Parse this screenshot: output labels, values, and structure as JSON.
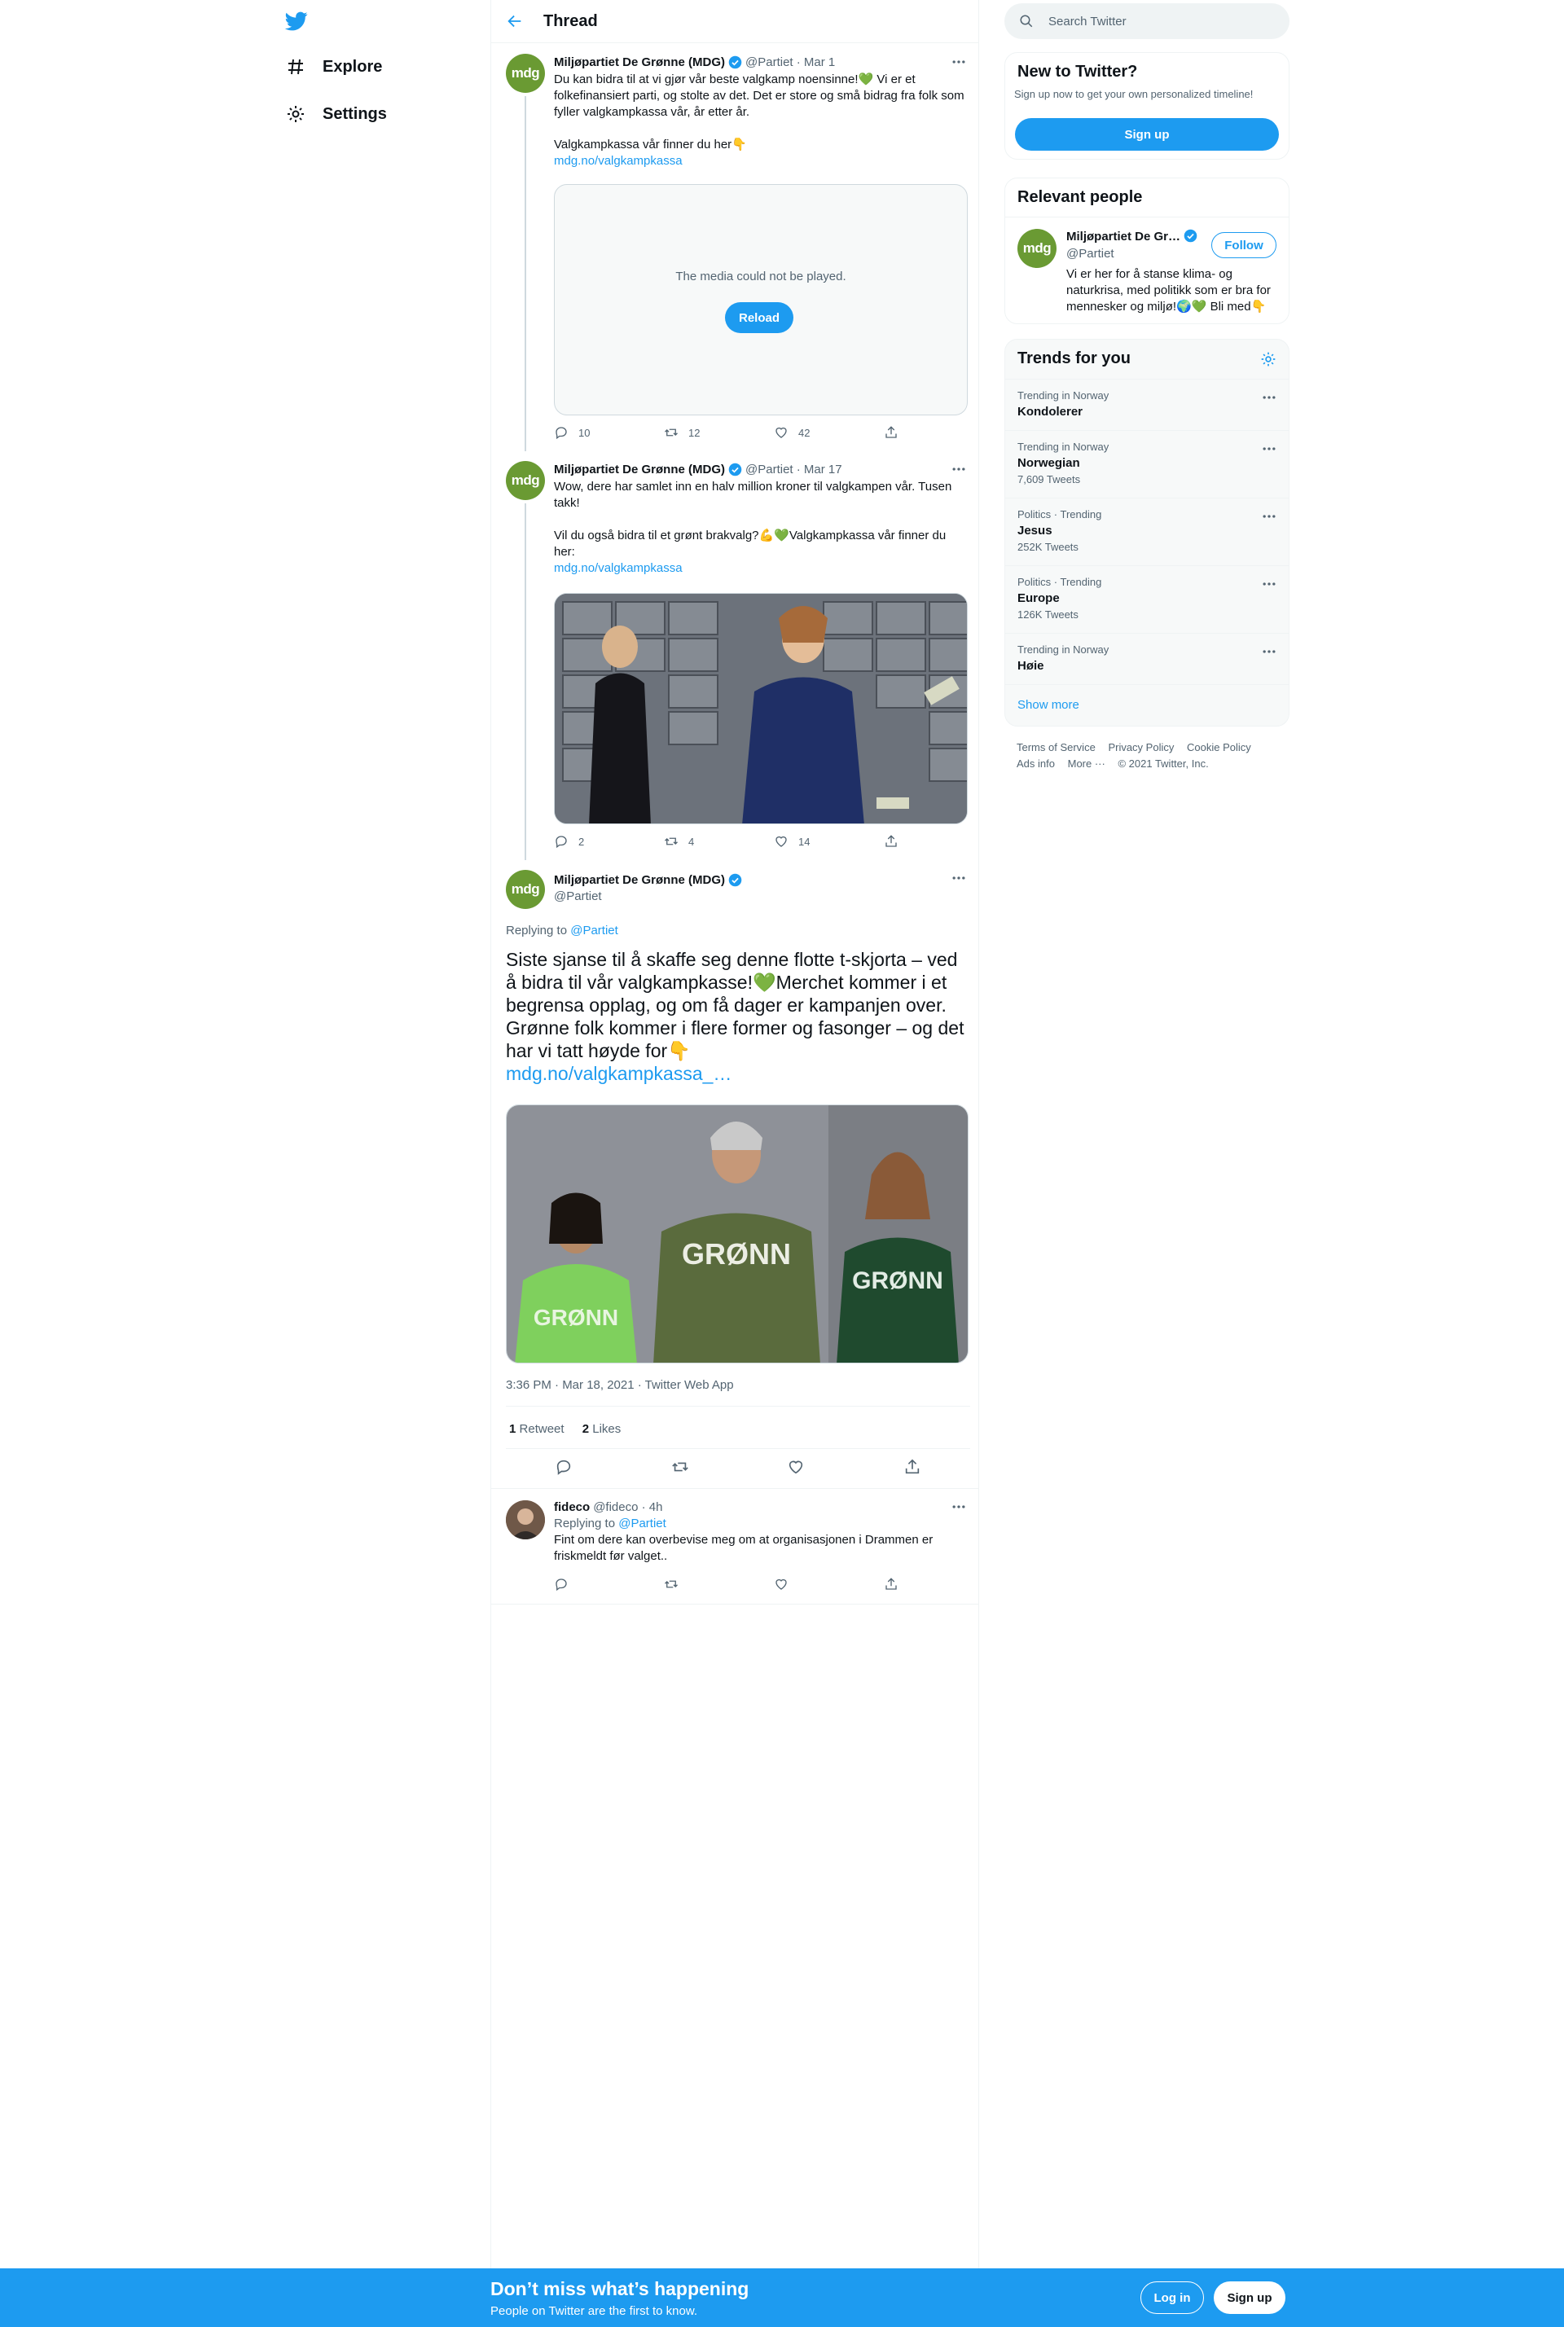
{
  "nav": {
    "explore": "Explore",
    "settings": "Settings"
  },
  "header": {
    "title": "Thread"
  },
  "tweets": [
    {
      "name": "Miljøpartiet De Grønne (MDG)",
      "avatar": "mdg",
      "meta": "@Partiet · Mar 1",
      "text": "Du kan bidra til at vi gjør vår beste valgkamp noensinne!💚 Vi er et folkefinansiert parti, og stolte av det. Det er store og små bidrag fra folk som fyller valgkampkassa vår, år etter år.\n\nValgkampkassa vår finner du her👇",
      "link": "mdg.no/valgkampkassa",
      "media_msg": "The media could not be played.",
      "reload": "Reload",
      "replies": "10",
      "retweets": "12",
      "likes": "42"
    },
    {
      "name": "Miljøpartiet De Grønne (MDG)",
      "avatar": "mdg",
      "meta": "@Partiet · Mar 17",
      "text": "Wow, dere har samlet inn en halv million kroner til valgkampen vår. Tusen takk!\n\nVil du også bidra til et grønt brakvalg?💪💚Valgkampkassa vår finner du her:",
      "link": "mdg.no/valgkampkassa",
      "replies": "2",
      "retweets": "4",
      "likes": "14"
    }
  ],
  "main_tweet": {
    "name": "Miljøpartiet De Grønne (MDG)",
    "handle": "@Partiet",
    "avatar": "mdg",
    "replying_prefix": "Replying to ",
    "replying_to": "@Partiet",
    "text": "Siste sjanse til å skaffe seg denne flotte t-skjorta – ved å bidra til vår valgkampkasse!💚Merchet kommer i et begrensa opplag, og om få dager er kampanjen over. Grønne folk kommer i flere former og fasonger – og det har vi tatt høyde for👇",
    "link": "mdg.no/valgkampkassa_…",
    "shirt_text": "GRØNN",
    "timestamp": "3:36 PM · Mar 18, 2021 · Twitter Web App",
    "retweets_num": "1",
    "retweets_label": "Retweet",
    "likes_num": "2",
    "likes_label": "Likes"
  },
  "reply": {
    "name": "fideco",
    "meta": "@fideco · 4h",
    "replying_prefix": "Replying to ",
    "replying_to": "@Partiet",
    "text": "Fint om dere kan overbevise meg om at organisasjonen i Drammen er friskmeldt før valget.."
  },
  "search": {
    "placeholder": "Search Twitter"
  },
  "new_to_twitter": {
    "title": "New to Twitter?",
    "subtitle": "Sign up now to get your own personalized timeline!",
    "signup": "Sign up"
  },
  "relevant": {
    "title": "Relevant people",
    "name": "Miljøpartiet De Gr…",
    "handle": "@Partiet",
    "avatar": "mdg",
    "follow": "Follow",
    "bio": "Vi er her for å stanse klima- og naturkrisa, med politikk som er bra for mennesker og miljø!🌍💚 Bli med👇"
  },
  "trends": {
    "title": "Trends for you",
    "items": [
      {
        "context": "Trending in Norway",
        "name": "Kondolerer",
        "count": ""
      },
      {
        "context": "Trending in Norway",
        "name": "Norwegian",
        "count": "7,609 Tweets"
      },
      {
        "context": "Politics · Trending",
        "name": "Jesus",
        "count": "252K Tweets"
      },
      {
        "context": "Politics · Trending",
        "name": "Europe",
        "count": "126K Tweets"
      },
      {
        "context": "Trending in Norway",
        "name": "Høie",
        "count": ""
      }
    ],
    "show_more": "Show more"
  },
  "footer": {
    "terms": "Terms of Service",
    "privacy": "Privacy Policy",
    "cookie": "Cookie Policy",
    "ads": "Ads info",
    "more": "More ···",
    "copyright": "© 2021 Twitter, Inc."
  },
  "bottom_bar": {
    "headline": "Don’t miss what’s happening",
    "subline": "People on Twitter are the first to know.",
    "login": "Log in",
    "signup": "Sign up"
  },
  "colors": {
    "accent": "#1d9bf0",
    "mdg_green": "#6a9a33"
  }
}
